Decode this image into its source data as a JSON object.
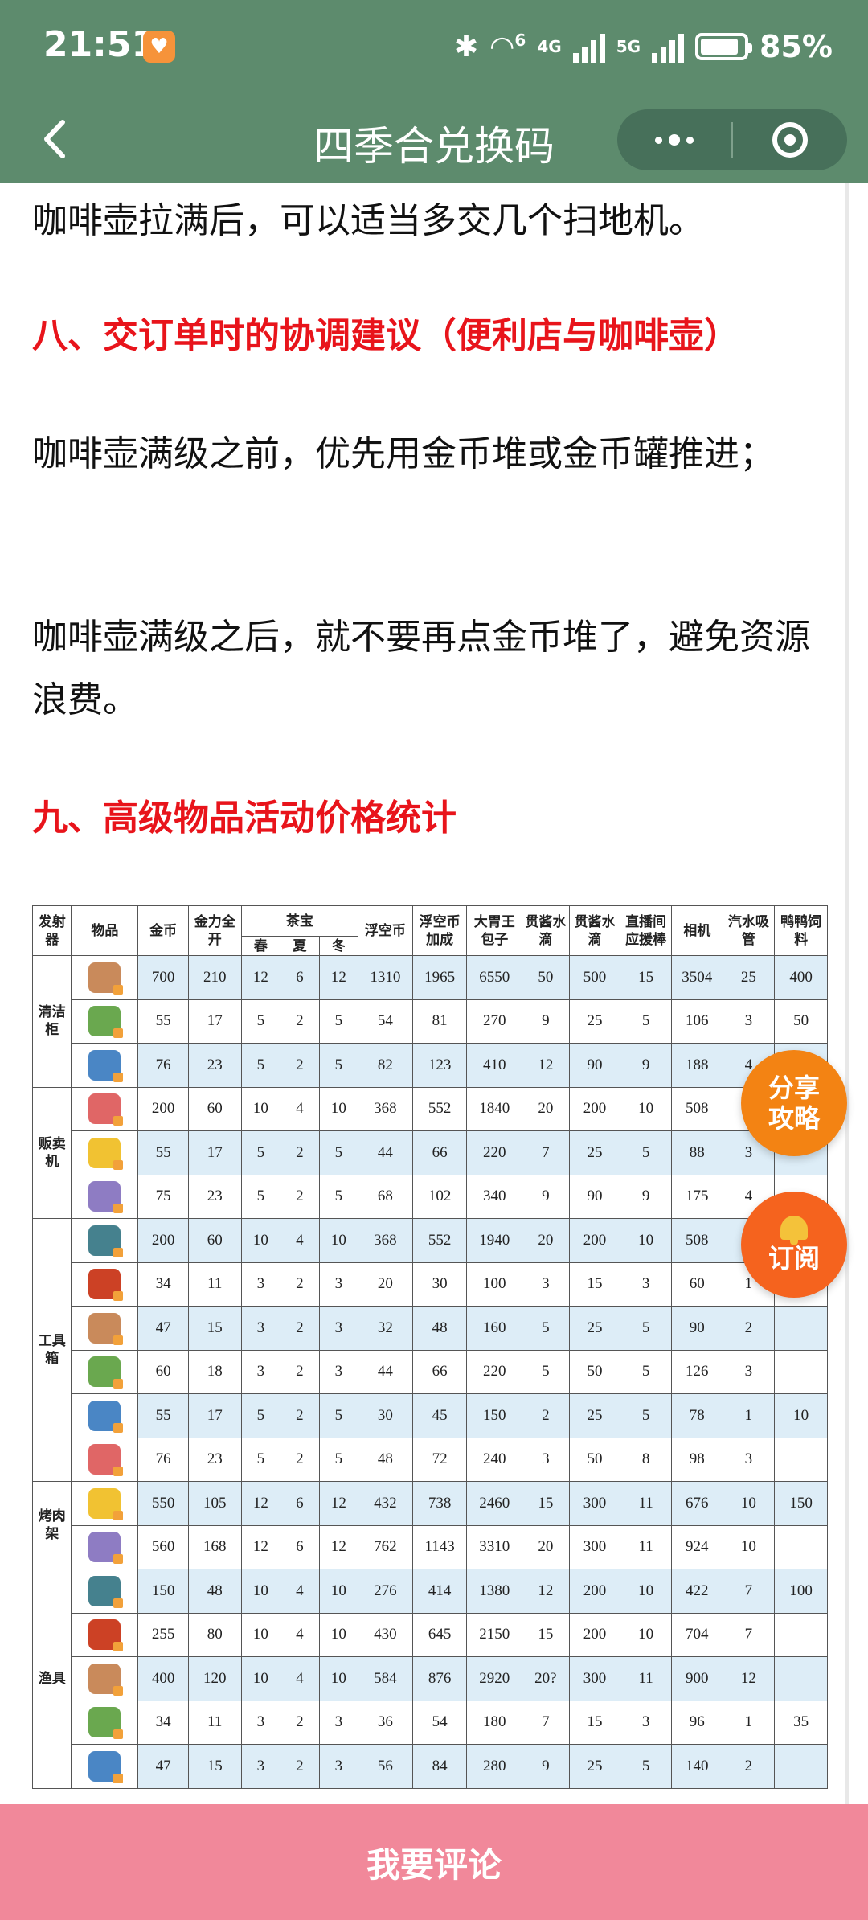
{
  "status_bar": {
    "time": "21:51",
    "app_badge_icon": "heart-icon",
    "network_wifi_tag": "6",
    "network_4g": "4G",
    "network_5g": "5G",
    "battery": "85%"
  },
  "nav": {
    "title": "四季合兑换码",
    "back_icon": "back-arrow-icon",
    "more_icon": "more-dots-icon",
    "close_icon": "miniprogram-close-icon"
  },
  "article": {
    "p1": "咖啡壶拉满后，可以适当多交几个扫地机。",
    "h8": "八、交订单时的协调建议（便利店与咖啡壶）",
    "p2": "咖啡壶满级之前，优先用金币堆或金币罐推进；",
    "p3": "咖啡壶满级之后，就不要再点金币堆了，避免资源浪费。",
    "h9": "九、高级物品活动价格统计"
  },
  "table": {
    "headers": {
      "launcher": "发射器",
      "item": "物品",
      "gold": "金币",
      "power": "金力全开",
      "treasure": "茶宝",
      "spring": "春",
      "summer": "夏",
      "winter": "冬",
      "float_coin": "浮空币",
      "float_bonus": "浮空币加成",
      "bun": "大胃王包子",
      "drip1": "贯酱水滴",
      "drip2": "贯酱水滴",
      "live": "直播间应援棒",
      "camera": "相机",
      "straw": "汽水吸管",
      "duck": "鸭鸭饲料"
    },
    "groups": [
      {
        "name": "清洁柜",
        "rows": [
          [
            "700",
            "210",
            "12",
            "6",
            "12",
            "1310",
            "1965",
            "6550",
            "50",
            "500",
            "15",
            "3504",
            "25",
            "400"
          ],
          [
            "55",
            "17",
            "5",
            "2",
            "5",
            "54",
            "81",
            "270",
            "9",
            "25",
            "5",
            "106",
            "3",
            "50"
          ],
          [
            "76",
            "23",
            "5",
            "2",
            "5",
            "82",
            "123",
            "410",
            "12",
            "90",
            "9",
            "188",
            "4",
            ""
          ]
        ]
      },
      {
        "name": "贩卖机",
        "rows": [
          [
            "200",
            "60",
            "10",
            "4",
            "10",
            "368",
            "552",
            "1840",
            "20",
            "200",
            "10",
            "508",
            "",
            ""
          ],
          [
            "55",
            "17",
            "5",
            "2",
            "5",
            "44",
            "66",
            "220",
            "7",
            "25",
            "5",
            "88",
            "3",
            ""
          ],
          [
            "75",
            "23",
            "5",
            "2",
            "5",
            "68",
            "102",
            "340",
            "9",
            "90",
            "9",
            "175",
            "4",
            ""
          ]
        ]
      },
      {
        "name": "工具箱",
        "rows": [
          [
            "200",
            "60",
            "10",
            "4",
            "10",
            "368",
            "552",
            "1940",
            "20",
            "200",
            "10",
            "508",
            "",
            ""
          ],
          [
            "34",
            "11",
            "3",
            "2",
            "3",
            "20",
            "30",
            "100",
            "3",
            "15",
            "3",
            "60",
            "1",
            ""
          ],
          [
            "47",
            "15",
            "3",
            "2",
            "3",
            "32",
            "48",
            "160",
            "5",
            "25",
            "5",
            "90",
            "2",
            ""
          ],
          [
            "60",
            "18",
            "3",
            "2",
            "3",
            "44",
            "66",
            "220",
            "5",
            "50",
            "5",
            "126",
            "3",
            ""
          ],
          [
            "55",
            "17",
            "5",
            "2",
            "5",
            "30",
            "45",
            "150",
            "2",
            "25",
            "5",
            "78",
            "1",
            "10"
          ],
          [
            "76",
            "23",
            "5",
            "2",
            "5",
            "48",
            "72",
            "240",
            "3",
            "50",
            "8",
            "98",
            "3",
            ""
          ]
        ]
      },
      {
        "name": "烤肉架",
        "rows": [
          [
            "550",
            "105",
            "12",
            "6",
            "12",
            "432",
            "738",
            "2460",
            "15",
            "300",
            "11",
            "676",
            "10",
            "150"
          ],
          [
            "560",
            "168",
            "12",
            "6",
            "12",
            "762",
            "1143",
            "3310",
            "20",
            "300",
            "11",
            "924",
            "10",
            ""
          ]
        ]
      },
      {
        "name": "渔具",
        "rows": [
          [
            "150",
            "48",
            "10",
            "4",
            "10",
            "276",
            "414",
            "1380",
            "12",
            "200",
            "10",
            "422",
            "7",
            "100"
          ],
          [
            "255",
            "80",
            "10",
            "4",
            "10",
            "430",
            "645",
            "2150",
            "15",
            "200",
            "10",
            "704",
            "7",
            ""
          ],
          [
            "400",
            "120",
            "10",
            "4",
            "10",
            "584",
            "876",
            "2920",
            "20?",
            "300",
            "11",
            "900",
            "12",
            ""
          ],
          [
            "34",
            "11",
            "3",
            "2",
            "3",
            "36",
            "54",
            "180",
            "7",
            "15",
            "3",
            "96",
            "1",
            "35"
          ],
          [
            "47",
            "15",
            "3",
            "2",
            "3",
            "56",
            "84",
            "280",
            "9",
            "25",
            "5",
            "140",
            "2",
            ""
          ]
        ]
      }
    ]
  },
  "fab": {
    "share": "分享攻略",
    "subscribe": "订阅"
  },
  "bottom": {
    "comment_button": "我要评论"
  },
  "colors": {
    "nav_bg": "#5d8b6d",
    "heading_red": "#e8141b",
    "share_orange": "#f38313",
    "bottom_pink": "#f1889a"
  }
}
